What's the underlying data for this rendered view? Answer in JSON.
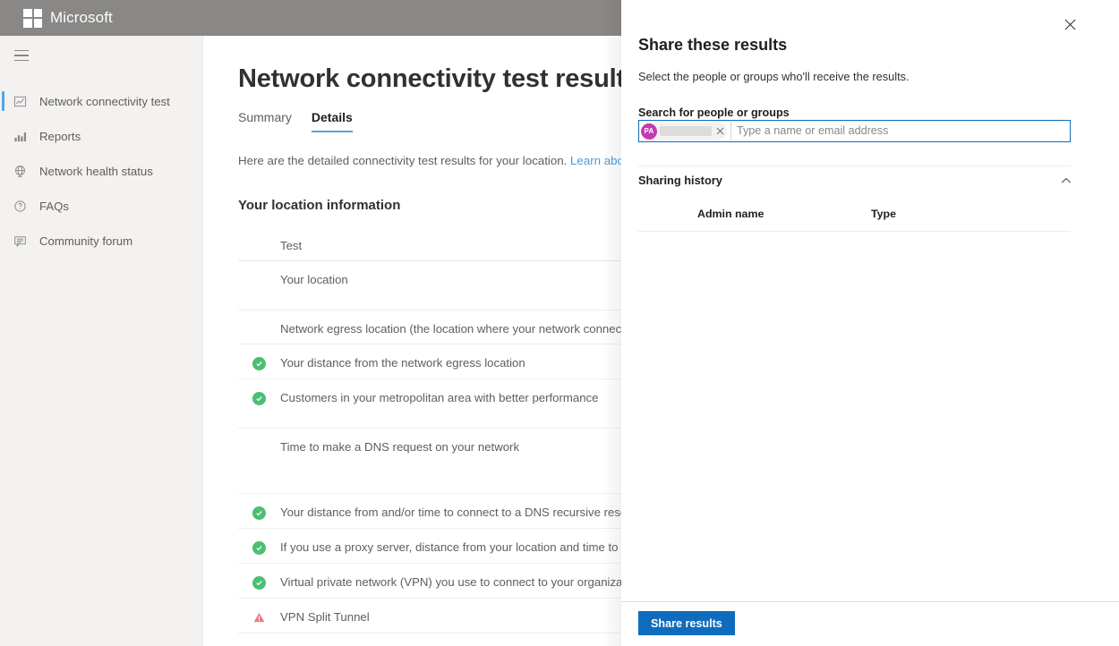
{
  "header": {
    "brand": "Microsoft",
    "logo_icon": "microsoft-logo-icon"
  },
  "sidebar": {
    "menu_icon": "hamburger-menu-icon",
    "items": [
      {
        "label": "Network connectivity test",
        "icon": "chart-image-icon",
        "active": true
      },
      {
        "label": "Reports",
        "icon": "bar-chart-icon",
        "active": false
      },
      {
        "label": "Network health status",
        "icon": "globe-icon",
        "active": false
      },
      {
        "label": "FAQs",
        "icon": "question-circle-icon",
        "active": false
      },
      {
        "label": "Community forum",
        "icon": "comment-icon",
        "active": false
      }
    ]
  },
  "main": {
    "page_title": "Network connectivity test results for your location",
    "tabs": [
      {
        "label": "Summary",
        "active": false
      },
      {
        "label": "Details",
        "active": true
      }
    ],
    "lede_text": "Here are the detailed connectivity test results for your location.",
    "lede_link": "Learn about the tests w",
    "section_title": "Your location information",
    "table": {
      "columns": [
        "Test"
      ],
      "rows": [
        {
          "status": "none",
          "label": "Your location"
        },
        {
          "status": "none",
          "label": "Network egress location (the location where your network connects to you"
        },
        {
          "status": "success",
          "label": "Your distance from the network egress location"
        },
        {
          "status": "success",
          "label": "Customers in your metropolitan area with better performance"
        },
        {
          "status": "none",
          "label": "Time to make a DNS request on your network"
        },
        {
          "status": "success",
          "label": "Your distance from and/or time to connect to a DNS recursive resolver"
        },
        {
          "status": "success",
          "label": "If you use a proxy server, distance from your location and time to connect"
        },
        {
          "status": "success",
          "label": "Virtual private network (VPN) you use to connect to your organization"
        },
        {
          "status": "warning",
          "label": "VPN Split Tunnel"
        }
      ]
    }
  },
  "panel": {
    "close_icon": "close-icon",
    "title": "Share these results",
    "subtitle": "Select the people or groups who'll receive the results.",
    "search": {
      "label": "Search for people or groups",
      "placeholder": "Type a name or email address",
      "value": "",
      "token": {
        "initials": "PA",
        "name": "",
        "remove_icon": "close-icon",
        "avatar_color": "#c239b3"
      }
    },
    "history": {
      "title": "Sharing history",
      "toggle_icon": "chevron-up-icon",
      "expanded": true,
      "columns": [
        "Admin name",
        "Type"
      ],
      "rows": []
    },
    "share_button": "Share results"
  },
  "colors": {
    "accent": "#0f6cbd",
    "tab_underline": "#4da6e8",
    "success": "#4bbf73",
    "warning": "#e8707a",
    "link": "#4a9ce0",
    "header_bar": "#8a8886",
    "sidebar_bg": "#f3f2f1"
  }
}
